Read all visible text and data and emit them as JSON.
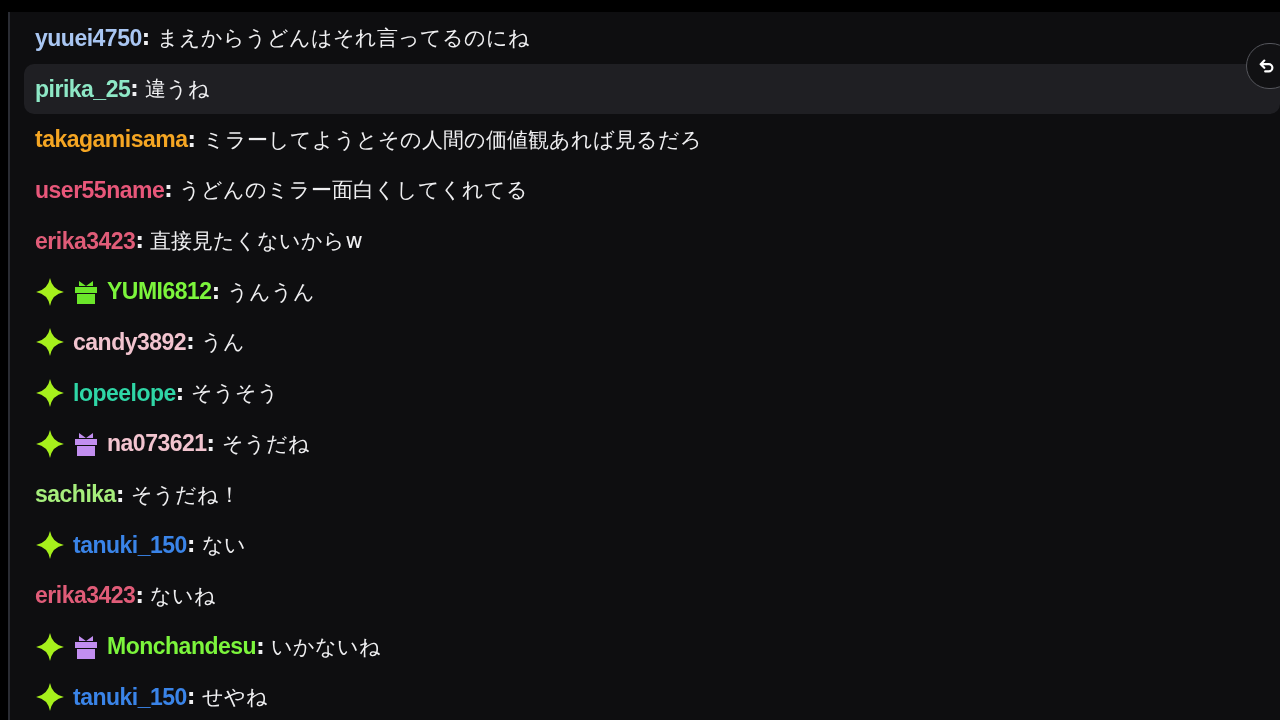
{
  "messages": [
    {
      "user": "yuuei4750",
      "color": "#a9c6f2",
      "text": "**:** まえからうどんはそれ言ってるのにね",
      "highlighted": false
    },
    {
      "user": "pirika_25",
      "color": "#8ee8c6",
      "text": "**:** 違うね",
      "highlighted": true
    },
    {
      "user": "takagamisama",
      "color": "#f5a623",
      "text": "**:** ミラーしてようとその人間の価値観あれば見るだろ",
      "highlighted": false
    },
    {
      "user": "user55name",
      "color": "#e8577a",
      "text": "**:** うどんのミラー面白くしてくれてる",
      "highlighted": false
    },
    {
      "user": "erika3423",
      "color": "#e05c78",
      "text": "**:** 直接見たくないからw",
      "highlighted": false
    },
    {
      "user": "YUMI6812",
      "color": "#7cf53c",
      "text": "**:** うんうん",
      "highlighted": false,
      "badges": [
        {
          "kind": "sparkle"
        },
        {
          "kind": "gift",
          "color": "#6be62a"
        }
      ]
    },
    {
      "user": "candy3892",
      "color": "#f2c4cf",
      "text": "**:** うん",
      "highlighted": false,
      "badges": [
        {
          "kind": "sparkle"
        }
      ]
    },
    {
      "user": "lopeelope",
      "color": "#2fd6a6",
      "text": "**:** そうそう",
      "highlighted": false,
      "badges": [
        {
          "kind": "sparkle"
        }
      ]
    },
    {
      "user": "na073621",
      "color": "#f2c4cf",
      "text": "**:** そうだね",
      "highlighted": false,
      "badges": [
        {
          "kind": "sparkle"
        },
        {
          "kind": "gift",
          "color": "#c28ef0"
        }
      ]
    },
    {
      "user": "sachika",
      "color": "#a6ee7c",
      "text": "**:** そうだね！",
      "highlighted": false
    },
    {
      "user": "tanuki_150",
      "color": "#3a84e8",
      "text": "**:** ない",
      "highlighted": false,
      "badges": [
        {
          "kind": "sparkle"
        }
      ]
    },
    {
      "user": "erika3423",
      "color": "#e05c78",
      "text": "**:** ないね",
      "highlighted": false
    },
    {
      "user": "Monchandesu",
      "color": "#7cf53c",
      "text": "**:** いかないね",
      "highlighted": false,
      "badges": [
        {
          "kind": "sparkle"
        },
        {
          "kind": "gift",
          "color": "#c28ef0"
        }
      ]
    },
    {
      "user": "tanuki_150",
      "color": "#3a84e8",
      "text": "**:** せやね",
      "highlighted": false,
      "badges": [
        {
          "kind": "sparkle"
        }
      ]
    }
  ]
}
